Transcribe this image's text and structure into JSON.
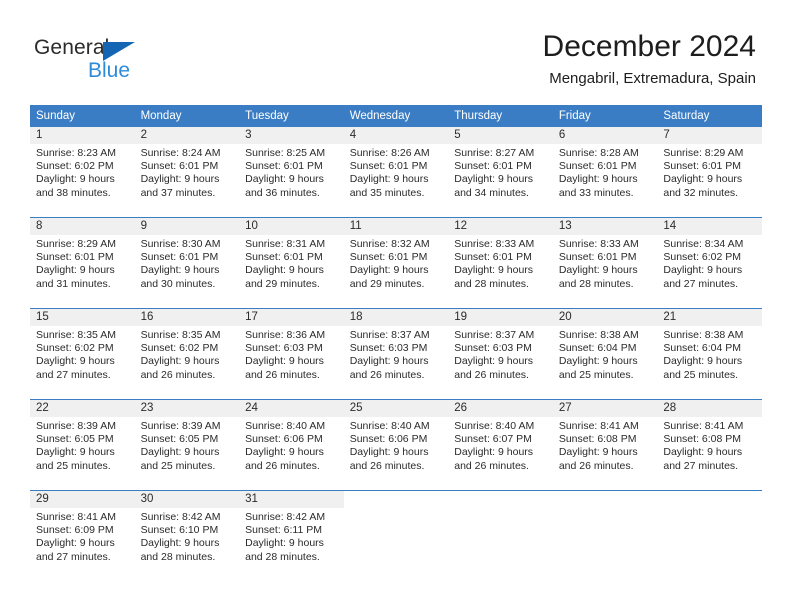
{
  "logo": {
    "word1": "General",
    "word2": "Blue",
    "triangle_color": "#1565b5",
    "blue_color": "#2e8bd8"
  },
  "header": {
    "title": "December 2024",
    "subtitle": "Mengabril, Extremadura, Spain"
  },
  "theme": {
    "header_blue": "#3b7dc4",
    "daynum_band": "#f0f0f0",
    "text": "#2b2b2b"
  },
  "weekday_headers": [
    "Sunday",
    "Monday",
    "Tuesday",
    "Wednesday",
    "Thursday",
    "Friday",
    "Saturday"
  ],
  "weeks": [
    [
      {
        "day": "1",
        "sunrise": "Sunrise: 8:23 AM",
        "sunset": "Sunset: 6:02 PM",
        "daylight1": "Daylight: 9 hours",
        "daylight2": "and 38 minutes."
      },
      {
        "day": "2",
        "sunrise": "Sunrise: 8:24 AM",
        "sunset": "Sunset: 6:01 PM",
        "daylight1": "Daylight: 9 hours",
        "daylight2": "and 37 minutes."
      },
      {
        "day": "3",
        "sunrise": "Sunrise: 8:25 AM",
        "sunset": "Sunset: 6:01 PM",
        "daylight1": "Daylight: 9 hours",
        "daylight2": "and 36 minutes."
      },
      {
        "day": "4",
        "sunrise": "Sunrise: 8:26 AM",
        "sunset": "Sunset: 6:01 PM",
        "daylight1": "Daylight: 9 hours",
        "daylight2": "and 35 minutes."
      },
      {
        "day": "5",
        "sunrise": "Sunrise: 8:27 AM",
        "sunset": "Sunset: 6:01 PM",
        "daylight1": "Daylight: 9 hours",
        "daylight2": "and 34 minutes."
      },
      {
        "day": "6",
        "sunrise": "Sunrise: 8:28 AM",
        "sunset": "Sunset: 6:01 PM",
        "daylight1": "Daylight: 9 hours",
        "daylight2": "and 33 minutes."
      },
      {
        "day": "7",
        "sunrise": "Sunrise: 8:29 AM",
        "sunset": "Sunset: 6:01 PM",
        "daylight1": "Daylight: 9 hours",
        "daylight2": "and 32 minutes."
      }
    ],
    [
      {
        "day": "8",
        "sunrise": "Sunrise: 8:29 AM",
        "sunset": "Sunset: 6:01 PM",
        "daylight1": "Daylight: 9 hours",
        "daylight2": "and 31 minutes."
      },
      {
        "day": "9",
        "sunrise": "Sunrise: 8:30 AM",
        "sunset": "Sunset: 6:01 PM",
        "daylight1": "Daylight: 9 hours",
        "daylight2": "and 30 minutes."
      },
      {
        "day": "10",
        "sunrise": "Sunrise: 8:31 AM",
        "sunset": "Sunset: 6:01 PM",
        "daylight1": "Daylight: 9 hours",
        "daylight2": "and 29 minutes."
      },
      {
        "day": "11",
        "sunrise": "Sunrise: 8:32 AM",
        "sunset": "Sunset: 6:01 PM",
        "daylight1": "Daylight: 9 hours",
        "daylight2": "and 29 minutes."
      },
      {
        "day": "12",
        "sunrise": "Sunrise: 8:33 AM",
        "sunset": "Sunset: 6:01 PM",
        "daylight1": "Daylight: 9 hours",
        "daylight2": "and 28 minutes."
      },
      {
        "day": "13",
        "sunrise": "Sunrise: 8:33 AM",
        "sunset": "Sunset: 6:01 PM",
        "daylight1": "Daylight: 9 hours",
        "daylight2": "and 28 minutes."
      },
      {
        "day": "14",
        "sunrise": "Sunrise: 8:34 AM",
        "sunset": "Sunset: 6:02 PM",
        "daylight1": "Daylight: 9 hours",
        "daylight2": "and 27 minutes."
      }
    ],
    [
      {
        "day": "15",
        "sunrise": "Sunrise: 8:35 AM",
        "sunset": "Sunset: 6:02 PM",
        "daylight1": "Daylight: 9 hours",
        "daylight2": "and 27 minutes."
      },
      {
        "day": "16",
        "sunrise": "Sunrise: 8:35 AM",
        "sunset": "Sunset: 6:02 PM",
        "daylight1": "Daylight: 9 hours",
        "daylight2": "and 26 minutes."
      },
      {
        "day": "17",
        "sunrise": "Sunrise: 8:36 AM",
        "sunset": "Sunset: 6:03 PM",
        "daylight1": "Daylight: 9 hours",
        "daylight2": "and 26 minutes."
      },
      {
        "day": "18",
        "sunrise": "Sunrise: 8:37 AM",
        "sunset": "Sunset: 6:03 PM",
        "daylight1": "Daylight: 9 hours",
        "daylight2": "and 26 minutes."
      },
      {
        "day": "19",
        "sunrise": "Sunrise: 8:37 AM",
        "sunset": "Sunset: 6:03 PM",
        "daylight1": "Daylight: 9 hours",
        "daylight2": "and 26 minutes."
      },
      {
        "day": "20",
        "sunrise": "Sunrise: 8:38 AM",
        "sunset": "Sunset: 6:04 PM",
        "daylight1": "Daylight: 9 hours",
        "daylight2": "and 25 minutes."
      },
      {
        "day": "21",
        "sunrise": "Sunrise: 8:38 AM",
        "sunset": "Sunset: 6:04 PM",
        "daylight1": "Daylight: 9 hours",
        "daylight2": "and 25 minutes."
      }
    ],
    [
      {
        "day": "22",
        "sunrise": "Sunrise: 8:39 AM",
        "sunset": "Sunset: 6:05 PM",
        "daylight1": "Daylight: 9 hours",
        "daylight2": "and 25 minutes."
      },
      {
        "day": "23",
        "sunrise": "Sunrise: 8:39 AM",
        "sunset": "Sunset: 6:05 PM",
        "daylight1": "Daylight: 9 hours",
        "daylight2": "and 25 minutes."
      },
      {
        "day": "24",
        "sunrise": "Sunrise: 8:40 AM",
        "sunset": "Sunset: 6:06 PM",
        "daylight1": "Daylight: 9 hours",
        "daylight2": "and 26 minutes."
      },
      {
        "day": "25",
        "sunrise": "Sunrise: 8:40 AM",
        "sunset": "Sunset: 6:06 PM",
        "daylight1": "Daylight: 9 hours",
        "daylight2": "and 26 minutes."
      },
      {
        "day": "26",
        "sunrise": "Sunrise: 8:40 AM",
        "sunset": "Sunset: 6:07 PM",
        "daylight1": "Daylight: 9 hours",
        "daylight2": "and 26 minutes."
      },
      {
        "day": "27",
        "sunrise": "Sunrise: 8:41 AM",
        "sunset": "Sunset: 6:08 PM",
        "daylight1": "Daylight: 9 hours",
        "daylight2": "and 26 minutes."
      },
      {
        "day": "28",
        "sunrise": "Sunrise: 8:41 AM",
        "sunset": "Sunset: 6:08 PM",
        "daylight1": "Daylight: 9 hours",
        "daylight2": "and 27 minutes."
      }
    ],
    [
      {
        "day": "29",
        "sunrise": "Sunrise: 8:41 AM",
        "sunset": "Sunset: 6:09 PM",
        "daylight1": "Daylight: 9 hours",
        "daylight2": "and 27 minutes."
      },
      {
        "day": "30",
        "sunrise": "Sunrise: 8:42 AM",
        "sunset": "Sunset: 6:10 PM",
        "daylight1": "Daylight: 9 hours",
        "daylight2": "and 28 minutes."
      },
      {
        "day": "31",
        "sunrise": "Sunrise: 8:42 AM",
        "sunset": "Sunset: 6:11 PM",
        "daylight1": "Daylight: 9 hours",
        "daylight2": "and 28 minutes."
      },
      {
        "day": "",
        "sunrise": "",
        "sunset": "",
        "daylight1": "",
        "daylight2": ""
      },
      {
        "day": "",
        "sunrise": "",
        "sunset": "",
        "daylight1": "",
        "daylight2": ""
      },
      {
        "day": "",
        "sunrise": "",
        "sunset": "",
        "daylight1": "",
        "daylight2": ""
      },
      {
        "day": "",
        "sunrise": "",
        "sunset": "",
        "daylight1": "",
        "daylight2": ""
      }
    ]
  ]
}
